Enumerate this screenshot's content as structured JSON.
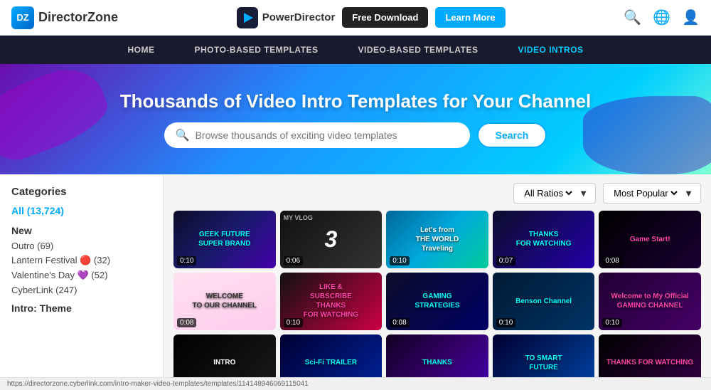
{
  "header": {
    "logo_dz": "DZ",
    "logo_text": "DirectorZone",
    "product_name": "PowerDirector",
    "btn_free_download": "Free Download",
    "btn_learn_more": "Learn More"
  },
  "nav": {
    "items": [
      {
        "label": "HOME",
        "active": false
      },
      {
        "label": "PHOTO-BASED TEMPLATES",
        "active": false
      },
      {
        "label": "VIDEO-BASED TEMPLATES",
        "active": false
      },
      {
        "label": "VIDEO INTROS",
        "active": true
      }
    ]
  },
  "hero": {
    "title": "Thousands of Video Intro Templates for Your Channel",
    "search_placeholder": "Browse thousands of exciting video templates",
    "search_button": "Search"
  },
  "sidebar": {
    "title": "Categories",
    "all_item": "All (13,724)",
    "new_section": "New",
    "new_items": [
      {
        "label": "Outro (69)"
      },
      {
        "label": "Lantern Festival 🔴 (32)"
      },
      {
        "label": "Valentine's Day 💜 (52)"
      },
      {
        "label": "CyberLink (247)"
      }
    ],
    "intro_theme_section": "Intro: Theme"
  },
  "toolbar": {
    "filter_label": "All Ratios",
    "sort_label": "Most Popular"
  },
  "videos": [
    {
      "id": "geek",
      "theme": "card-geek",
      "text": "GEEK FUTURE\nSUPER BRAND",
      "color": "cyan",
      "duration": "0:10"
    },
    {
      "id": "vlog",
      "theme": "card-vlog",
      "text": "3",
      "color": "",
      "duration": "0:06"
    },
    {
      "id": "world",
      "theme": "card-world",
      "text": "Let's from\nTHE WORLD\nTraveling",
      "color": "",
      "duration": "0:10"
    },
    {
      "id": "thanks1",
      "theme": "card-thanks1",
      "text": "THANKS\nFOR WATCHING",
      "color": "cyan",
      "duration": "0:07"
    },
    {
      "id": "game",
      "theme": "card-game",
      "text": "Game Start!",
      "color": "pink",
      "duration": "0:08"
    },
    {
      "id": "welcome",
      "theme": "card-welcome",
      "text": "WELCOME\nTO OUR CHANNEL",
      "color": "dark",
      "duration": "0:08"
    },
    {
      "id": "subscribe",
      "theme": "card-subscribe",
      "text": "LIKE &\nSUBSCRIBE\nTHANKS\nFOR WATCHING",
      "color": "pink",
      "duration": "0:10"
    },
    {
      "id": "gaming",
      "theme": "card-gaming",
      "text": "GAMING\nSTRATEGIES",
      "color": "cyan",
      "duration": "0:08"
    },
    {
      "id": "benson",
      "theme": "card-benson",
      "text": "Benson Channel",
      "color": "cyan",
      "duration": "0:10"
    },
    {
      "id": "gaming2",
      "theme": "card-gaming2",
      "text": "Welcome to My Official\nGAMING CHANNEL",
      "color": "pink",
      "duration": "0:10"
    },
    {
      "id": "intro",
      "theme": "card-intro",
      "text": "INTRO",
      "color": "",
      "duration": ""
    },
    {
      "id": "scifi",
      "theme": "card-scifi",
      "text": "Sci-Fi TRAILER",
      "color": "cyan",
      "duration": ""
    },
    {
      "id": "thanks2",
      "theme": "card-thanks2",
      "text": "THANKS",
      "color": "cyan",
      "duration": ""
    },
    {
      "id": "smart",
      "theme": "card-smart",
      "text": "TO SMART\nFUTURE",
      "color": "cyan",
      "duration": ""
    },
    {
      "id": "thanks3",
      "theme": "card-thanks3",
      "text": "THANKS FOR WATCHING",
      "color": "pink",
      "duration": ""
    }
  ],
  "status_bar": {
    "url": "https://directorzone.cyberlink.com/intro-maker-video-templates/templates/114148946069115041"
  }
}
